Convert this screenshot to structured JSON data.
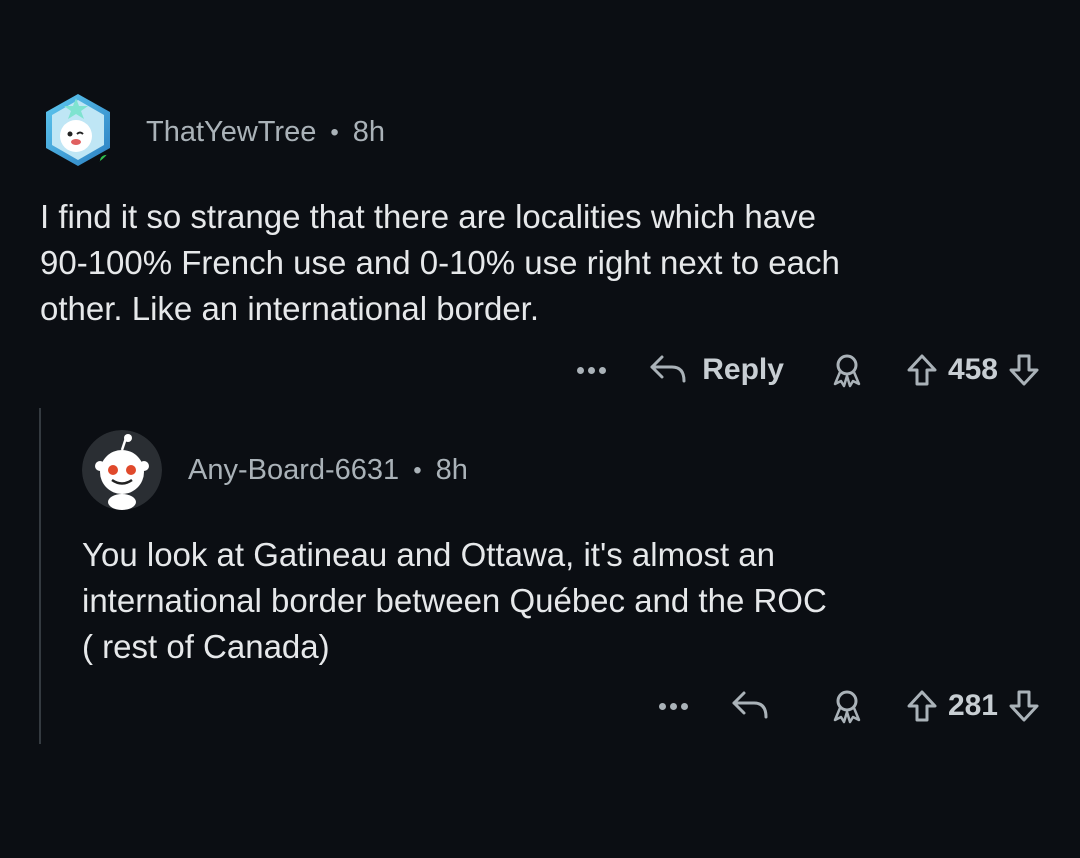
{
  "comments": [
    {
      "username": "ThatYewTree",
      "separator": "•",
      "time": "8h",
      "body_lines": [
        "I find it so strange that there are localities which have",
        "90-100% French use and 0-10% use right next to each",
        "other. Like an international border."
      ],
      "reply_label": "Reply",
      "score": "458",
      "online": true
    },
    {
      "username": "Any-Board-6631",
      "separator": "•",
      "time": "8h",
      "body_lines": [
        "You look at Gatineau and Ottawa, it's almost an",
        "international border between Québec and the ROC",
        "( rest of Canada)"
      ],
      "score": "281"
    }
  ],
  "icons": {
    "more": "ellipsis-icon",
    "reply": "reply-arrow-icon",
    "award": "award-icon",
    "upvote": "upvote-arrow-icon",
    "downvote": "downvote-arrow-icon"
  },
  "colors": {
    "background": "#0b0e13",
    "text": "#e6e8ea",
    "muted": "#aab2b8",
    "online": "#2fbf4f"
  }
}
